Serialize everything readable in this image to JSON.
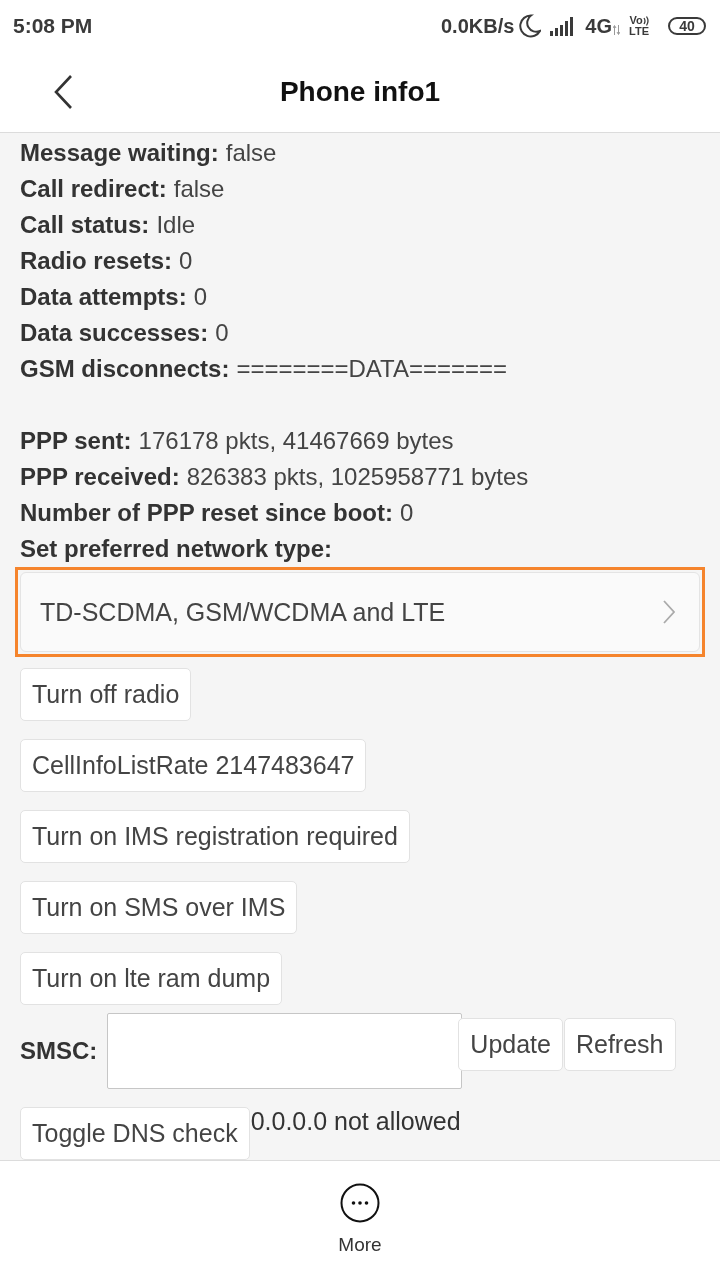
{
  "status_bar": {
    "time": "5:08 PM",
    "speed": "0.0KB/s",
    "network": "4G",
    "volte_top": "Vo",
    "volte_bottom": "LTE",
    "battery": "40"
  },
  "header": {
    "title": "Phone info1"
  },
  "info_rows": [
    {
      "label": "Message waiting:",
      "value": "false"
    },
    {
      "label": "Call redirect:",
      "value": "false"
    },
    {
      "label": "Call status:",
      "value": "Idle"
    },
    {
      "label": "Radio resets:",
      "value": "0"
    },
    {
      "label": "Data attempts:",
      "value": "0"
    },
    {
      "label": "Data successes:",
      "value": "0"
    },
    {
      "label": "GSM disconnects:",
      "value": "========DATA======="
    }
  ],
  "ppp_rows": [
    {
      "label": "PPP sent:",
      "value": "176178 pkts, 41467669 bytes"
    },
    {
      "label": "PPP received:",
      "value": "826383 pkts, 1025958771 bytes"
    },
    {
      "label": "Number of PPP reset since boot:",
      "value": "0"
    }
  ],
  "network_type": {
    "label": "Set preferred network type:",
    "value": "TD-SCDMA, GSM/WCDMA and LTE",
    "highlighted": true
  },
  "buttons": [
    "Turn off radio",
    "CellInfoListRate 2147483647",
    "Turn on IMS registration required",
    "Turn on SMS over IMS",
    "Turn on lte ram dump"
  ],
  "smsc": {
    "label": "SMSC:",
    "buttons": [
      "Update",
      "Refresh"
    ]
  },
  "dns": {
    "button": "Toggle DNS check",
    "status": "0.0.0.0 not allowed"
  },
  "bottom_bar": {
    "label": "More"
  }
}
